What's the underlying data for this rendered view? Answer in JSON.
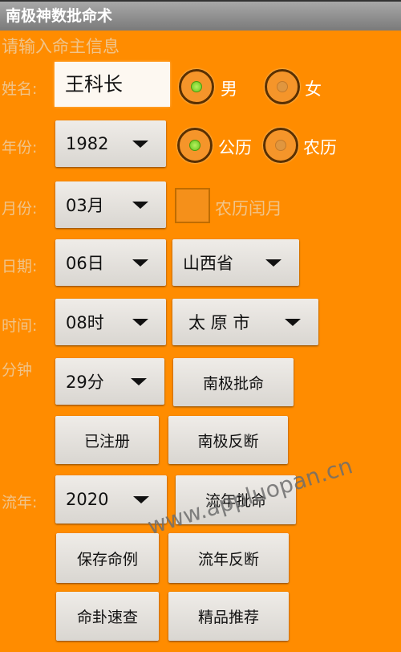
{
  "title": "南极神数批命术",
  "prompt": "请输入命主信息",
  "labels": {
    "name": "姓名:",
    "year": "年份:",
    "month": "月份:",
    "day": "日期:",
    "time": "时间:",
    "minute": "分钟",
    "liunian": "流年:"
  },
  "name_value": "王科长",
  "gender": {
    "male": "男",
    "female": "女",
    "selected": "男"
  },
  "calendar": {
    "solar": "公历",
    "lunar": "农历",
    "selected": "公历"
  },
  "leap_month": {
    "label": "农历闰月",
    "checked": false
  },
  "spinners": {
    "year": "1982",
    "month": "03月",
    "day": "06日",
    "province": "山西省",
    "hour": "08时",
    "city": "太 原 市",
    "minute": "29分",
    "liunian": "2020"
  },
  "buttons": {
    "nanji_piming": "南极批命",
    "registered": "已注册",
    "nanji_fanduan": "南极反断",
    "liunian_piming": "流年批命",
    "save": "保存命例",
    "liunian_fanduan": "流年反断",
    "minggua": "命卦速查",
    "recommend": "精品推荐"
  },
  "watermark": "www.appluopan.cn",
  "colors": {
    "background": "#ff8c00",
    "titlebar": "#8a8a8a",
    "radio_selected": "#7ed321"
  }
}
